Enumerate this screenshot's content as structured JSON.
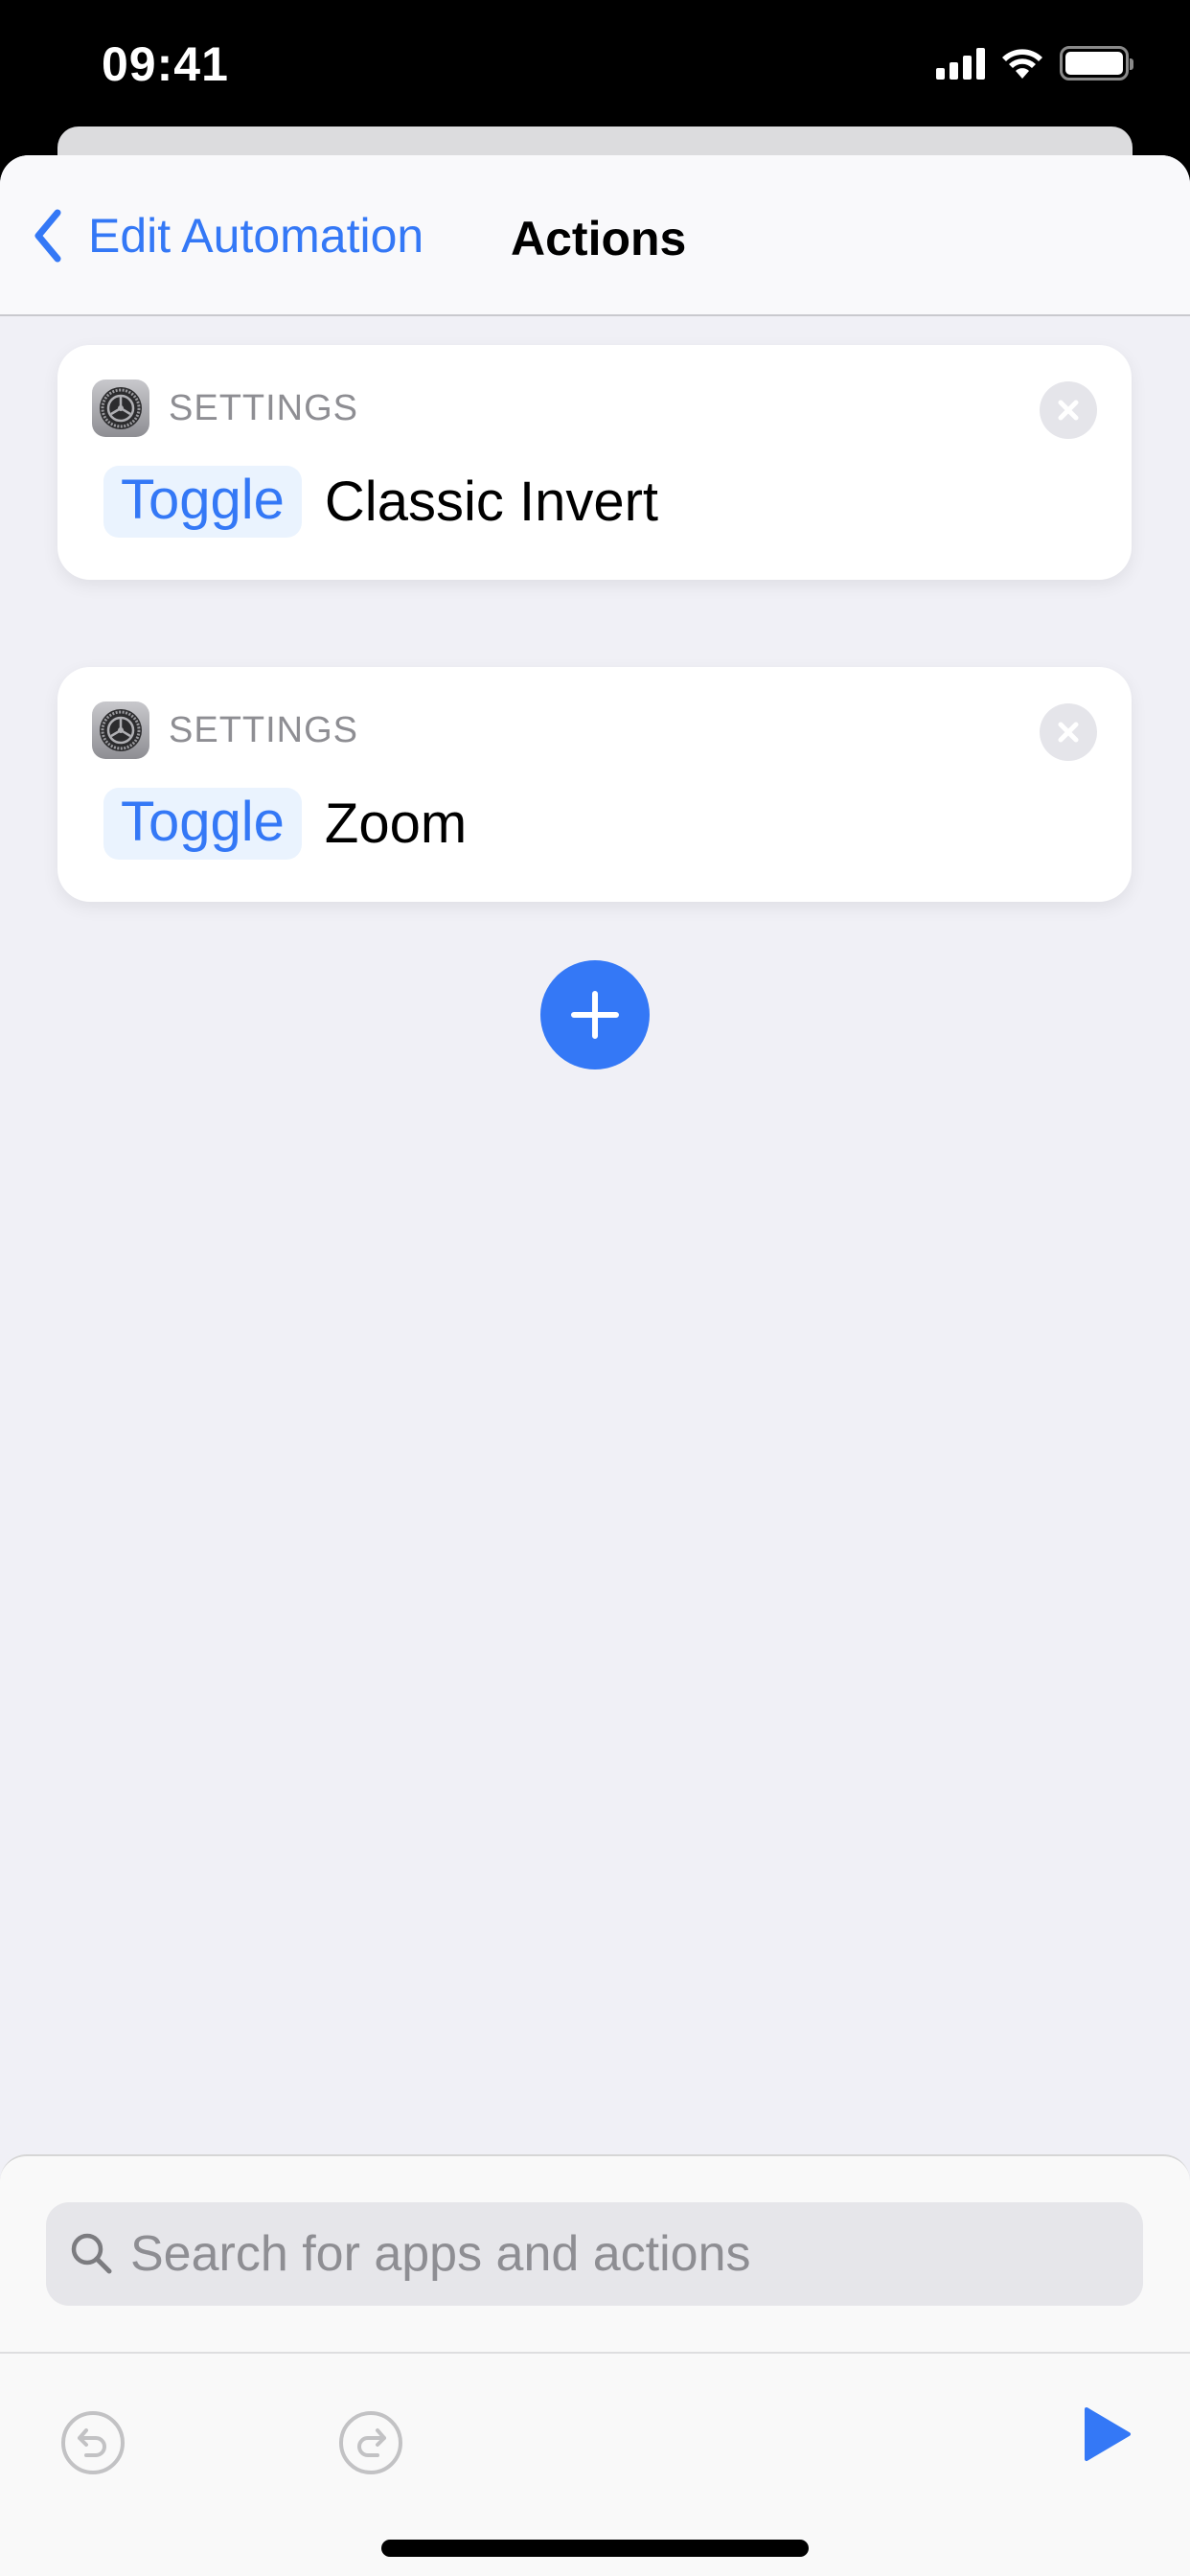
{
  "status_bar": {
    "time": "09:41",
    "icons": [
      "cellular-signal-icon",
      "wifi-icon",
      "battery-icon"
    ]
  },
  "nav": {
    "back_label": "Edit Automation",
    "title": "Actions"
  },
  "actions": [
    {
      "app_icon": "settings-gear-icon",
      "app_label": "SETTINGS",
      "verb": "Toggle",
      "target": "Classic Invert"
    },
    {
      "app_icon": "settings-gear-icon",
      "app_label": "SETTINGS",
      "verb": "Toggle",
      "target": "Zoom"
    }
  ],
  "add_button": {
    "icon": "plus-icon"
  },
  "search": {
    "placeholder": "Search for apps and actions",
    "value": ""
  },
  "toolbar": {
    "undo_icon": "undo-icon",
    "redo_icon": "redo-icon",
    "run_icon": "play-icon"
  },
  "colors": {
    "accent": "#3478f6",
    "background": "#f0f0f6",
    "card": "#ffffff",
    "secondary_text": "#8e8e93"
  }
}
